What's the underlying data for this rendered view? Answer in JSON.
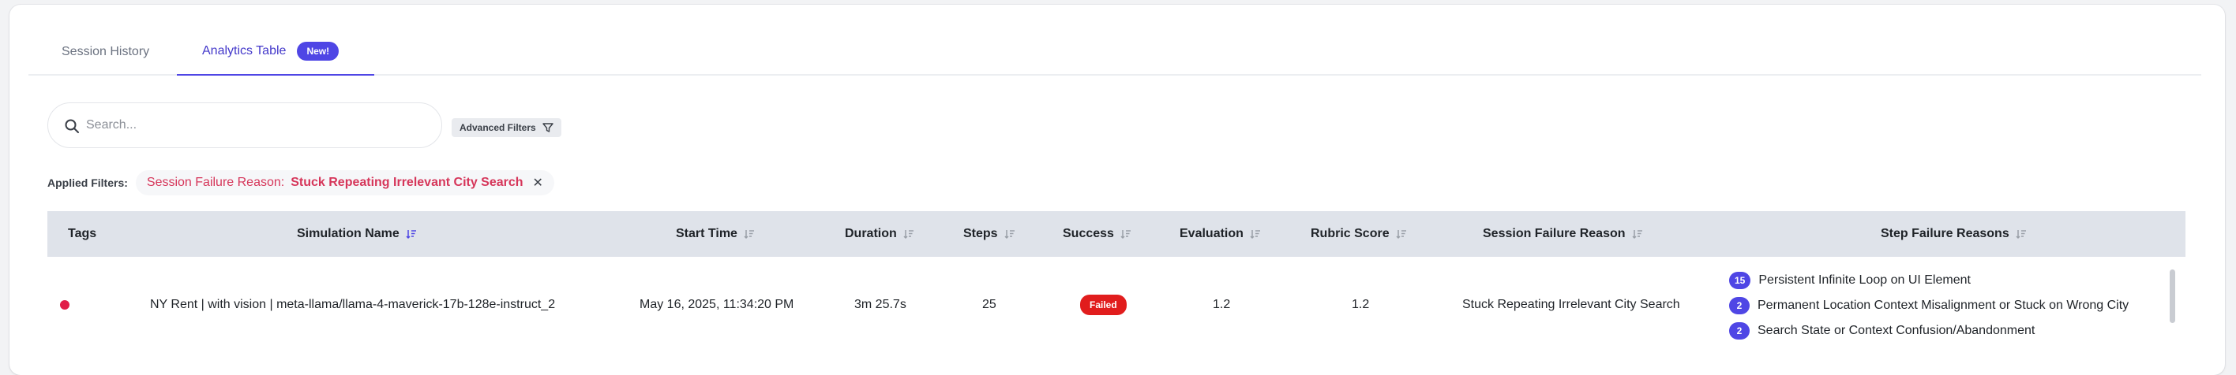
{
  "tabs": {
    "history": "Session History",
    "analytics": "Analytics Table",
    "new_badge": "New!"
  },
  "search": {
    "placeholder": "Search..."
  },
  "advanced_filters_label": "Advanced Filters",
  "applied_filters": {
    "label": "Applied Filters:",
    "chip_key": "Session Failure Reason:",
    "chip_value": "Stuck Repeating Irrelevant City Search",
    "chip_close": "✕"
  },
  "table": {
    "headers": {
      "tags": "Tags",
      "simulation_name": "Simulation Name",
      "start_time": "Start Time",
      "duration": "Duration",
      "steps": "Steps",
      "success": "Success",
      "evaluation": "Evaluation",
      "rubric_score": "Rubric Score",
      "session_failure_reason": "Session Failure Reason",
      "step_failure_reasons": "Step Failure Reasons"
    },
    "rows": [
      {
        "tag_color": "#e11d48",
        "simulation_name": "NY Rent | with vision | meta-llama/llama-4-maverick-17b-128e-instruct_2",
        "start_time": "May 16, 2025, 11:34:20 PM",
        "duration": "3m 25.7s",
        "steps": "25",
        "success": "Failed",
        "evaluation": "1.2",
        "rubric_score": "1.2",
        "session_failure_reason": "Stuck Repeating Irrelevant City Search",
        "step_failure_reasons": [
          {
            "count": "15",
            "text": "Persistent Infinite Loop on UI Element"
          },
          {
            "count": "2",
            "text": "Permanent Location Context Misalignment or Stuck on Wrong City"
          },
          {
            "count": "2",
            "text": "Search State or Context Confusion/Abandonment"
          }
        ]
      }
    ]
  },
  "colors": {
    "accent": "#4f46e5",
    "danger": "#e11d1d",
    "filter_red": "#d6365a",
    "header_bg": "#dfe3ea"
  }
}
